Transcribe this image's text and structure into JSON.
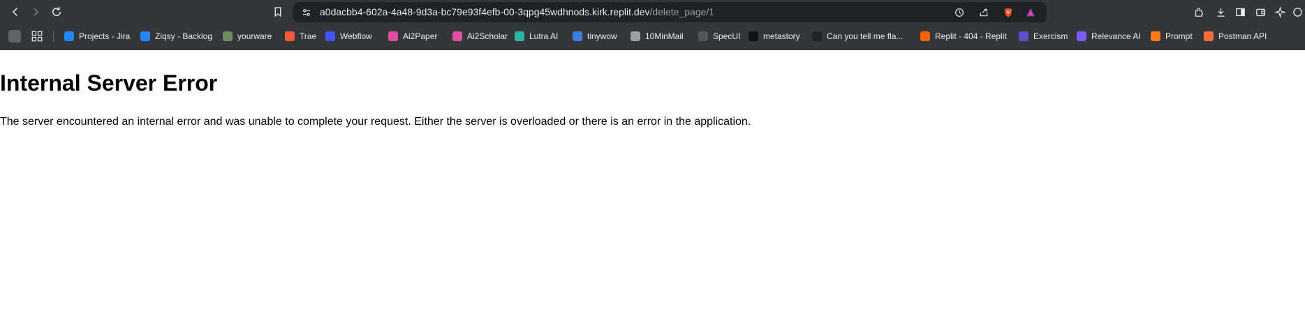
{
  "browser": {
    "url_host": "a0dacbb4-602a-4a48-9d3a-bc79e93f4efb-00-3qpg45wdhnods.kirk.replit.dev",
    "url_path": "/delete_page/1",
    "bookmarks": [
      {
        "label": "Projects - Jira",
        "icon": "jira-icon",
        "color": "#2684ff"
      },
      {
        "label": "Ziqsy - Backlog",
        "icon": "jira-icon",
        "color": "#2684ff"
      },
      {
        "label": "yourware",
        "icon": "yourware-icon",
        "color": "#6b8e5a"
      },
      {
        "label": "Trae",
        "icon": "trae-icon",
        "color": "#f05a3a"
      },
      {
        "label": "Webflow",
        "icon": "webflow-icon",
        "color": "#4353ff"
      },
      {
        "label": "Ai2Paper",
        "icon": "ai2-icon",
        "color": "#e04fa0"
      },
      {
        "label": "Ai2Scholar",
        "icon": "ai2-icon",
        "color": "#e04fa0"
      },
      {
        "label": "Lutra AI",
        "icon": "lutra-icon",
        "color": "#2bb5a0"
      },
      {
        "label": "tinywow",
        "icon": "tinywow-icon",
        "color": "#3b7de0"
      },
      {
        "label": "10MinMail",
        "icon": "globe-icon",
        "color": "#9aa0a6"
      },
      {
        "label": "SpecUI",
        "icon": "specui-icon",
        "color": "#555555"
      },
      {
        "label": "metastory",
        "icon": "metastory-icon",
        "color": "#111111"
      },
      {
        "label": "Can you tell me fla...",
        "icon": "chat-icon",
        "color": "#222222"
      },
      {
        "label": "Replit - 404 - Replit",
        "icon": "replit-icon",
        "color": "#f26207"
      },
      {
        "label": "Exercism",
        "icon": "exercism-icon",
        "color": "#604fcd"
      },
      {
        "label": "Relevance AI",
        "icon": "relevance-icon",
        "color": "#7b5cff"
      },
      {
        "label": "Prompt",
        "icon": "flame-icon",
        "color": "#ff7a1a"
      },
      {
        "label": "Postman API",
        "icon": "postman-icon",
        "color": "#ff6c37"
      }
    ]
  },
  "page": {
    "heading": "Internal Server Error",
    "message": "The server encountered an internal error and was unable to complete your request. Either the server is overloaded or there is an error in the application."
  }
}
